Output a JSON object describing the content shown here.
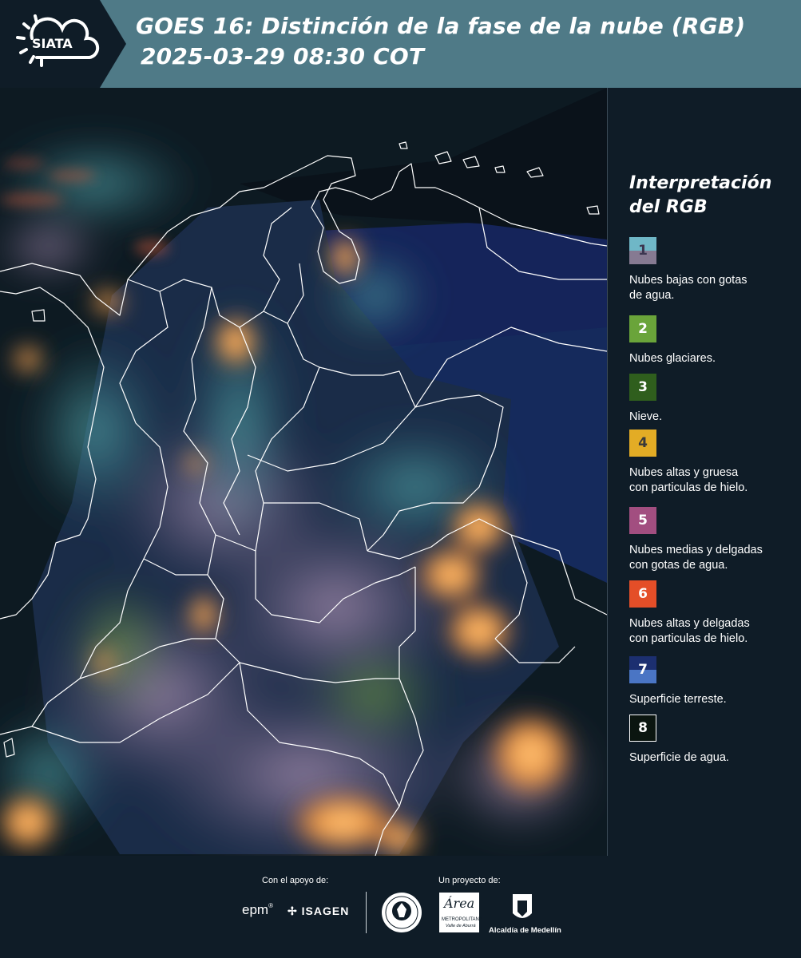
{
  "header": {
    "logo_text": "SIATA",
    "title_line1": "GOES 16: Distinción de la fase de la nube (RGB)",
    "title_line2": "2025-03-29 08:30 COT"
  },
  "legend": {
    "title": "Interpretación del RGB",
    "items": [
      {
        "num": "1",
        "top_color": "#6fb7c7",
        "bottom_color": "#867a92",
        "num_color": "#3c3650",
        "label": "Nubes bajas con gotas\nde agua."
      },
      {
        "num": "2",
        "top_color": "#6aa43a",
        "bottom_color": "#6aa43a",
        "num_color": "#ffffff",
        "label": "Nubes glaciares."
      },
      {
        "num": "3",
        "top_color": "#2f5e1d",
        "bottom_color": "#2f5e1d",
        "num_color": "#ffffff",
        "label": "Nieve."
      },
      {
        "num": "4",
        "top_color": "#e3ac25",
        "bottom_color": "#e3ac25",
        "num_color": "#3a3a3a",
        "label": "Nubes altas y gruesa\ncon particulas de hielo."
      },
      {
        "num": "5",
        "top_color": "#a24e80",
        "bottom_color": "#a24e80",
        "num_color": "#ffffff",
        "label": "Nubes medias y delgadas\ncon gotas de agua."
      },
      {
        "num": "6",
        "top_color": "#e44e28",
        "bottom_color": "#e44e28",
        "num_color": "#ffffff",
        "label": "Nubes altas y delgadas\ncon particulas de hielo."
      },
      {
        "num": "7",
        "top_color": "#1c2f70",
        "bottom_color": "#4a75c4",
        "num_color": "#ffffff",
        "label": "Superficie terreste."
      },
      {
        "num": "8",
        "top_color": "#0b1510",
        "bottom_color": "#0b1510",
        "num_color": "#ffffff",
        "label": "Superficie de agua."
      }
    ]
  },
  "footer": {
    "support_label": "Con el apoyo de:",
    "project_label": "Un proyecto de:",
    "sponsor_epm": "epm",
    "sponsor_isagen": "ISAGEN",
    "partner_area": "Área",
    "partner_area_sub1": "METROPOLITANA",
    "partner_area_sub2": "Valle de Aburrá",
    "partner_alcaldia": "Alcaldía de Medellín"
  }
}
